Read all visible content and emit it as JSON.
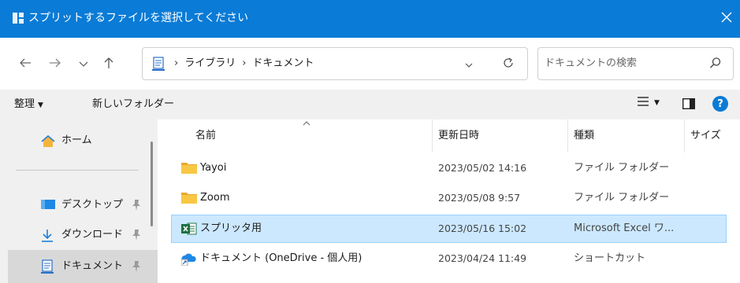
{
  "window": {
    "title": "スプリットするファイルを選択してください",
    "accent": "#0a7bd6"
  },
  "nav": {
    "breadcrumb": [
      "ライブラリ",
      "ドキュメント"
    ],
    "breadcrumb_separator": "›",
    "search_placeholder": "ドキュメントの検索"
  },
  "toolbar": {
    "organize_label": "整理",
    "new_folder_label": "新しいフォルダー"
  },
  "sidebar": {
    "items": [
      {
        "label": "ホーム",
        "icon": "home-icon"
      },
      {
        "label": "デスクトップ",
        "icon": "desktop-icon",
        "pinned": true
      },
      {
        "label": "ダウンロード",
        "icon": "download-icon",
        "pinned": true
      },
      {
        "label": "ドキュメント",
        "icon": "documents-icon",
        "pinned": true,
        "selected": true
      }
    ]
  },
  "filelist": {
    "columns": [
      "名前",
      "更新日時",
      "種類",
      "サイズ"
    ],
    "sorted_by": "名前",
    "rows": [
      {
        "name": "Yayoi",
        "date": "2023/05/02 14:16",
        "type": "ファイル フォルダー",
        "icon": "folder-icon"
      },
      {
        "name": "Zoom",
        "date": "2023/05/08 9:57",
        "type": "ファイル フォルダー",
        "icon": "folder-icon"
      },
      {
        "name": "スプリッタ用",
        "date": "2023/05/16 15:02",
        "type": "Microsoft Excel ワ...",
        "icon": "excel-file-icon",
        "selected": true
      },
      {
        "name": "ドキュメント (OneDrive - 個人用)",
        "date": "2023/04/24 11:49",
        "type": "ショートカット",
        "icon": "onedrive-shortcut-icon"
      }
    ]
  }
}
